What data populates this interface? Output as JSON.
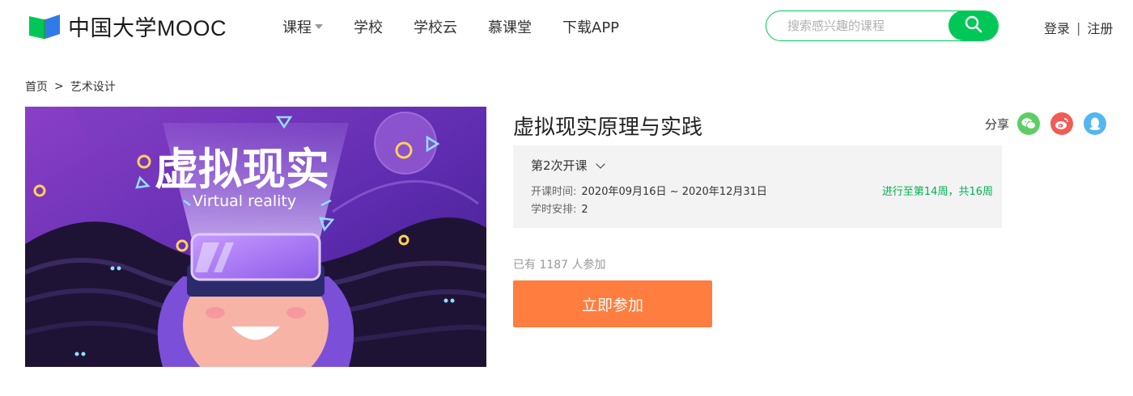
{
  "header": {
    "logo_text": "中国大学MOOC",
    "nav": [
      {
        "label": "课程",
        "has_dropdown": true
      },
      {
        "label": "学校",
        "has_dropdown": false
      },
      {
        "label": "学校云",
        "has_dropdown": false
      },
      {
        "label": "慕课堂",
        "has_dropdown": false
      },
      {
        "label": "下载APP",
        "has_dropdown": false
      }
    ],
    "search": {
      "placeholder": "搜索感兴趣的课程",
      "value": "",
      "button_icon": "search-icon"
    },
    "auth": {
      "login": "登录",
      "separator": "|",
      "register": "注册"
    }
  },
  "breadcrumb": {
    "home": "首页",
    "arrow": ">",
    "category": "艺术设计"
  },
  "banner": {
    "title_cn": "虚拟现实",
    "title_en": "Virtual reality"
  },
  "course": {
    "title": "虚拟现实原理与实践",
    "share": {
      "label": "分享",
      "icons": [
        "wechat-icon",
        "weibo-icon",
        "qq-icon"
      ]
    },
    "term": {
      "selected": "第2次开课",
      "time_label": "开课时间:",
      "time_value": "2020年09月16日 ~ 2020年12月31日",
      "hours_label": "学时安排:",
      "hours_value": "2",
      "progress": "进行至第14周，共16周"
    },
    "enrolled": "已有 1187 人参加",
    "join_button": "立即参加"
  },
  "colors": {
    "brand_green": "#00c758",
    "join_orange": "#ff7d3e",
    "progress_green": "#00b152",
    "wechat": "#5fcd66",
    "weibo": "#f15c55",
    "qq": "#54b6f0"
  }
}
